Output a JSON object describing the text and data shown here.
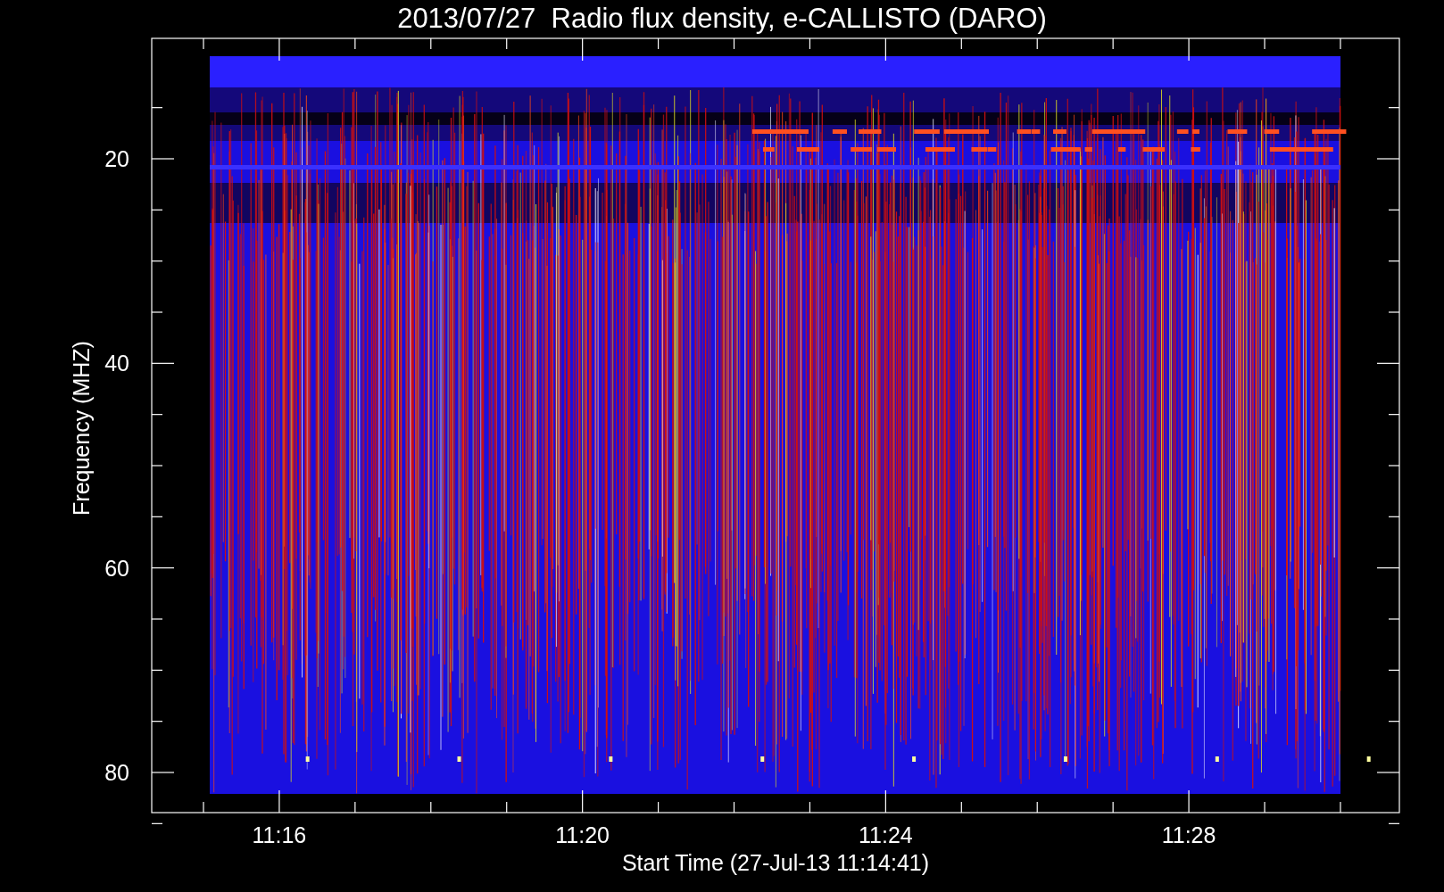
{
  "title": "2013/07/27  Radio flux density, e-CALLISTO (DARO)",
  "y_axis": {
    "label": "Frequency (MHZ)",
    "ticks": [
      "20",
      "40",
      "60",
      "80"
    ]
  },
  "x_axis": {
    "label": "Start Time (27-Jul-13 11:14:41)",
    "ticks": [
      "11:16",
      "11:20",
      "11:24",
      "11:28"
    ]
  }
}
